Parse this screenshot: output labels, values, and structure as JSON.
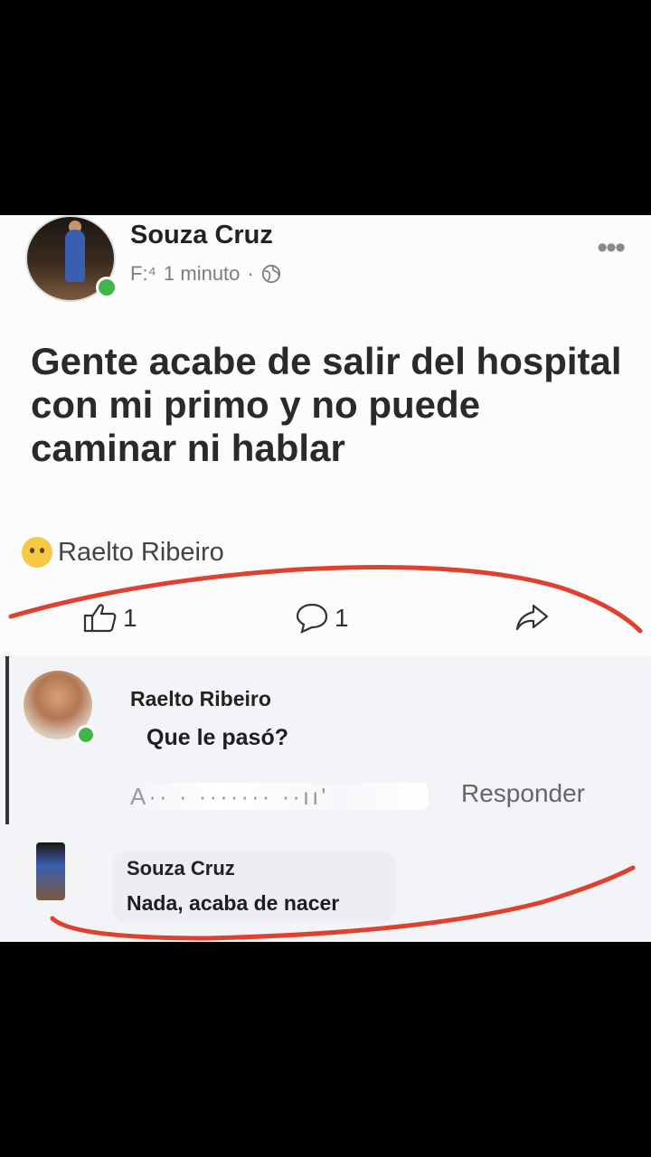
{
  "post": {
    "author": "Souza Cruz",
    "meta_prefix": "F:⁴",
    "time": "1 minuto",
    "separator": "·",
    "more": "•••",
    "text": "Gente acabe de salir del hospital con mi primo y no puede caminar ni hablar",
    "reactor_name": "Raelto Ribeiro",
    "reaction_icon": "sad-emoji",
    "like_count": "1",
    "comment_count": "1"
  },
  "comments": [
    {
      "author": "Raelto Ribeiro",
      "text": "Que le pasó?",
      "actions_obscured": "A··  ·  ·······  ··ıı'",
      "reply_label": "Responder"
    },
    {
      "author": "Souza Cruz",
      "text": "Nada, acaba de nacer"
    }
  ],
  "colors": {
    "annotation_red": "#e0412f",
    "online_green": "#3fb54a",
    "card_bg": "#fcfcfd",
    "comments_bg": "#f2f4f8"
  }
}
